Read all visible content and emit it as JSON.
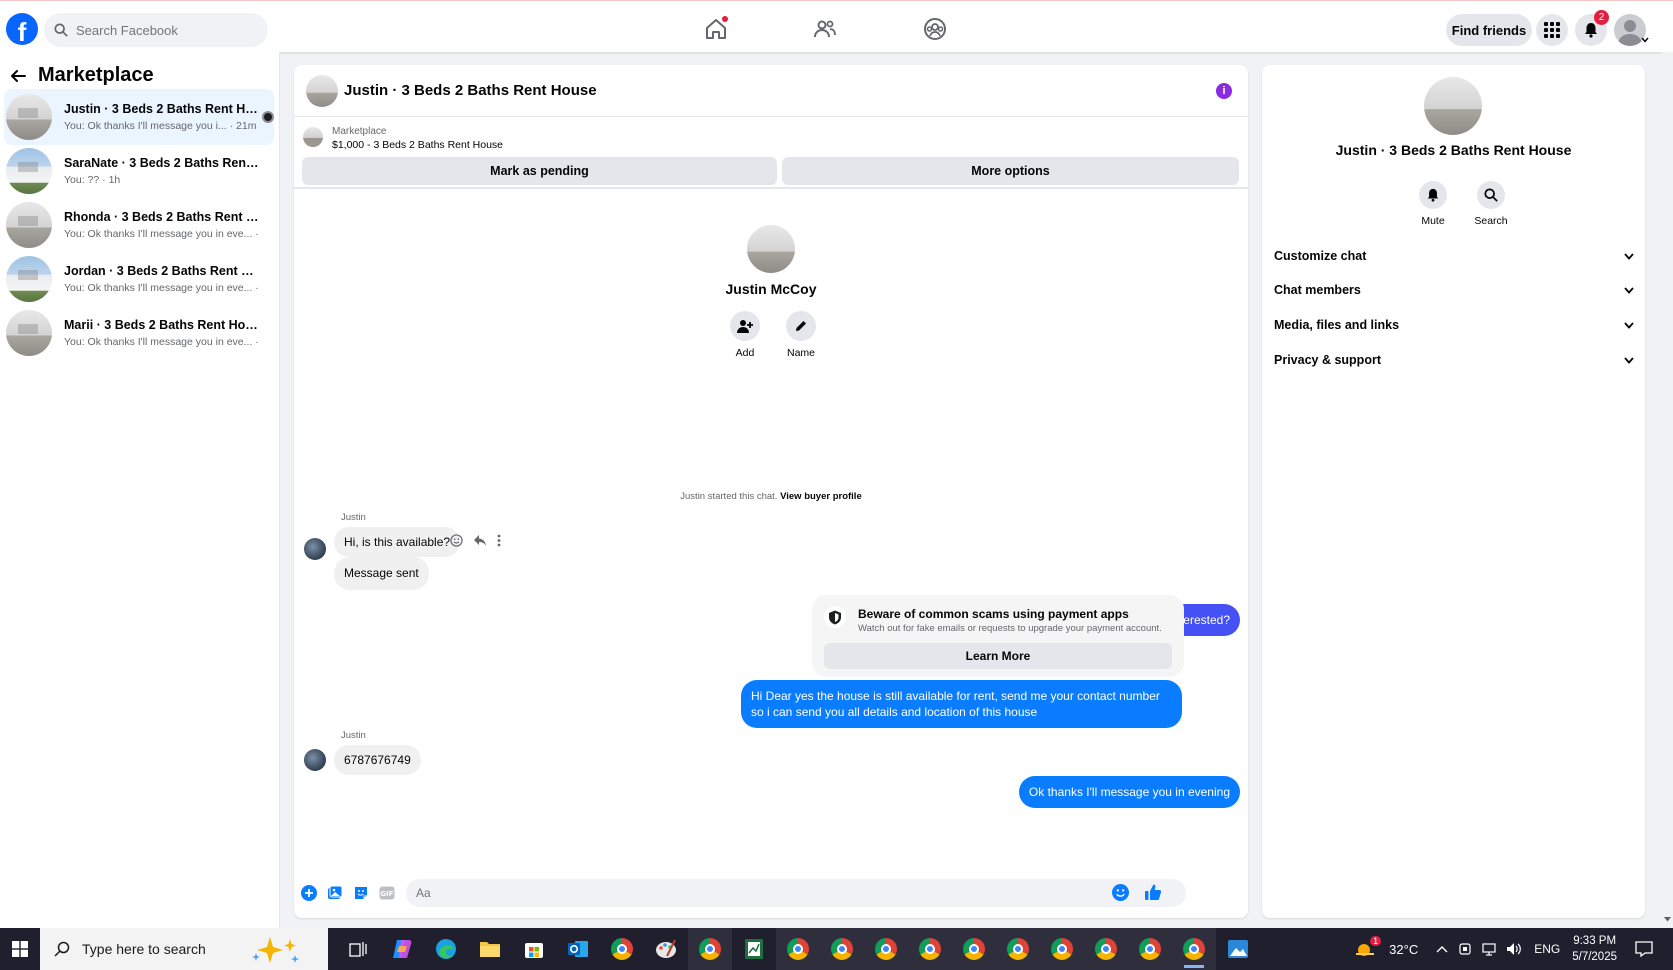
{
  "topbar": {
    "search_placeholder": "Search Facebook",
    "find_friends_label": "Find friends",
    "notification_count": "2"
  },
  "sidebar": {
    "title": "Marketplace",
    "conversations": [
      {
        "title": "Justin · 3 Beds 2 Baths Rent Hou...",
        "preview": "You: Ok thanks I'll message you i... · 21m",
        "active": true
      },
      {
        "title": "SaraNate · 3 Beds 2 Baths Rent Ho...",
        "preview": "You: ?? · 1h"
      },
      {
        "title": "Rhonda · 3 Beds 2 Baths Rent House",
        "preview": "You: Ok thanks I'll message you in eve... · 1h"
      },
      {
        "title": "Jordan · 3 Beds 2 Baths Rent House",
        "preview": "You: Ok thanks I'll message you in eve... · 2h"
      },
      {
        "title": "Marii · 3 Beds 2 Baths Rent House",
        "preview": "You: Ok thanks I'll message you in eve... · 2h"
      }
    ]
  },
  "chat": {
    "title": "Justin · 3 Beds 2 Baths Rent House",
    "listing": {
      "label": "Marketplace",
      "price_title": "$1,000 - 3 Beds 2 Baths Rent House",
      "mark_pending_label": "Mark as pending",
      "more_options_label": "More options"
    },
    "profile": {
      "name": "Justin McCoy",
      "add_label": "Add",
      "name_label": "Name"
    },
    "system_line": {
      "text": "Justin started this chat.",
      "link": "View buyer profile"
    },
    "messages": {
      "sender_1": "Justin",
      "in_1": "Hi, is this available?",
      "in_2": "Message sent",
      "out_1": "Yes, are you interested?",
      "out_2": "Hi Dear yes the house is still available for rent, send me your contact number so i can send you all details and location of this house",
      "sender_2": "Justin",
      "in_3": "6787676749",
      "out_3": "Ok thanks I'll message you in evening"
    },
    "scam_notice": {
      "title": "Beware of common scams using payment apps",
      "subtitle": "Watch out for fake emails or requests to upgrade your payment account.",
      "button": "Learn More"
    },
    "composer": {
      "placeholder": "Aa"
    }
  },
  "right_panel": {
    "title": "Justin · 3 Beds 2 Baths Rent House",
    "mute_label": "Mute",
    "search_label": "Search",
    "sections": [
      "Customize chat",
      "Chat members",
      "Media, files and links",
      "Privacy & support"
    ]
  },
  "taskbar": {
    "search_placeholder": "Type here to search",
    "temperature": "32°C",
    "language": "ENG",
    "time": "9:33 PM",
    "date": "5/7/2025",
    "weather_badge": "1"
  },
  "colors": {
    "brand_blue": "#0866ff",
    "outgoing_bubble": "#0a7cff",
    "outgoing_bubble_alt": "#4651f5",
    "notification_red": "#e41e3f",
    "info_purple": "#8a2be2"
  }
}
